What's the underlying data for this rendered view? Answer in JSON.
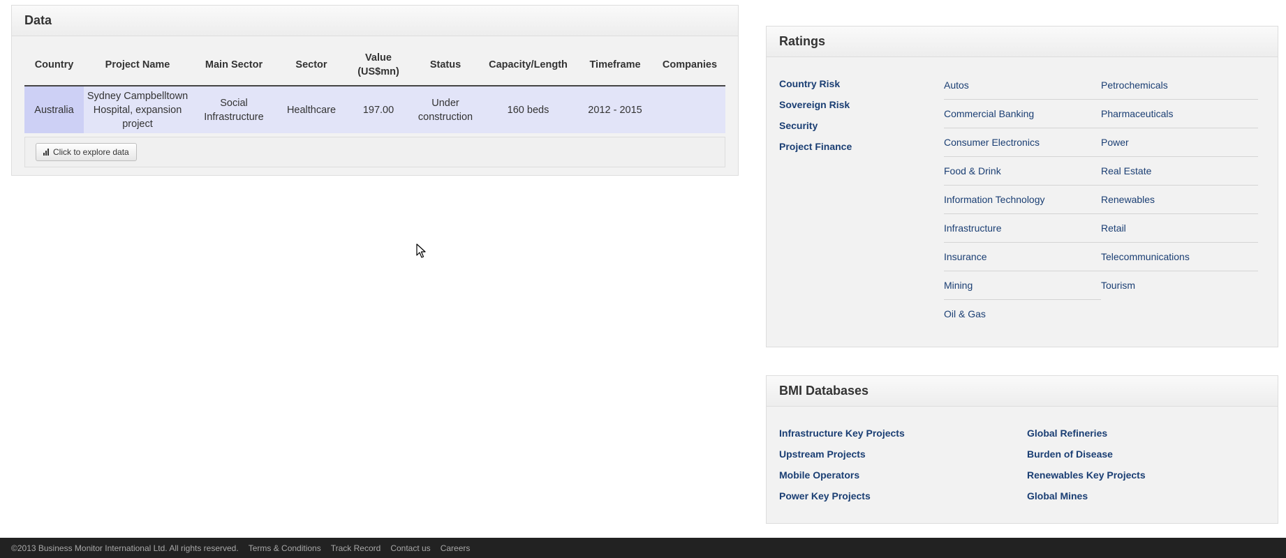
{
  "data_panel": {
    "title": "Data",
    "columns": [
      "Country",
      "Project Name",
      "Main Sector",
      "Sector",
      "Value (US$mn)",
      "Status",
      "Capacity/Length",
      "Timeframe",
      "Companies"
    ],
    "rows": [
      {
        "country": "Australia",
        "project_name": "Sydney Campbelltown Hospital, expansion project",
        "main_sector": "Social Infrastructure",
        "sector": "Healthcare",
        "value": "197.00",
        "status": "Under construction",
        "capacity": "160 beds",
        "timeframe": "2012 - 2015",
        "companies": ""
      }
    ],
    "explore_button": "Click to explore data"
  },
  "ratings": {
    "title": "Ratings",
    "main_links": [
      "Country Risk",
      "Sovereign Risk",
      "Security",
      "Project Finance"
    ],
    "col1": [
      "Autos",
      "Commercial Banking",
      "Consumer Electronics",
      "Food & Drink",
      "Information Technology",
      "Infrastructure",
      "Insurance",
      "Mining",
      "Oil & Gas"
    ],
    "col2": [
      "Petrochemicals",
      "Pharmaceuticals",
      "Power",
      "Real Estate",
      "Renewables",
      "Retail",
      "Telecommunications",
      "Tourism"
    ]
  },
  "bmi": {
    "title": "BMI Databases",
    "col1": [
      "Infrastructure Key Projects",
      "Upstream Projects",
      "Mobile Operators",
      "Power Key Projects"
    ],
    "col2": [
      "Global Refineries",
      "Burden of Disease",
      "Renewables Key Projects",
      "Global Mines"
    ]
  },
  "footer": {
    "copyright": "©2013 Business Monitor International Ltd. All rights reserved.",
    "links": [
      "Terms & Conditions",
      "Track Record",
      "Contact us",
      "Careers"
    ]
  }
}
